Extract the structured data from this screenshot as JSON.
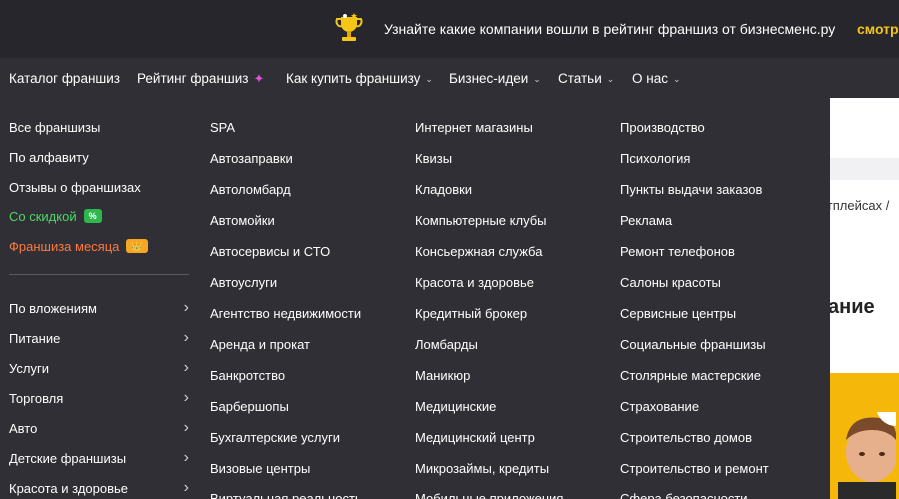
{
  "promo": {
    "text": "Узнайте какие компании вошли в рейтинг франшиз от бизнесменс.ру",
    "link": "смотреть"
  },
  "nav": {
    "catalog": "Каталог франшиз",
    "rating": "Рейтинг франшиз",
    "how_to_buy": "Как купить франшизу",
    "ideas": "Бизнес-идеи",
    "articles": "Статьи",
    "about": "О нас"
  },
  "left_links": {
    "all": "Все франшизы",
    "alphabet": "По алфавиту",
    "reviews": "Отзывы о франшизах",
    "discount": "Со скидкой",
    "discount_badge": "%",
    "month": "Франшиза месяца",
    "month_badge": "👑"
  },
  "categories": [
    "По вложениям",
    "Питание",
    "Услуги",
    "Торговля",
    "Авто",
    "Детские франшизы",
    "Красота и здоровье"
  ],
  "columns": [
    [
      "SPA",
      "Автозаправки",
      "Автоломбард",
      "Автомойки",
      "Автосервисы и СТО",
      "Автоуслуги",
      "Агентство недвижимости",
      "Аренда и прокат",
      "Банкротство",
      "Барбершопы",
      "Бухгалтерские услуги",
      "Визовые центры",
      "Виртуальная реальность"
    ],
    [
      "Интернет магазины",
      "Квизы",
      "Кладовки",
      "Компьютерные клубы",
      "Консьержная служба",
      "Красота и здоровье",
      "Кредитный брокер",
      "Ломбарды",
      "Маникюр",
      "Медицинские",
      "Медицинский центр",
      "Микрозаймы, кредиты",
      "Мобильные приложения"
    ],
    [
      "Производство",
      "Психология",
      "Пункты выдачи заказов",
      "Реклама",
      "Ремонт телефонов",
      "Салоны красоты",
      "Сервисные центры",
      "Социальные франшизы",
      "Столярные мастерские",
      "Страхование",
      "Строительство домов",
      "Строительство и ремонт",
      "Сфера безопасности"
    ]
  ],
  "background": {
    "crumb": "етплейсах /",
    "heading": "ание"
  },
  "colors": {
    "bg": "#2f2f35",
    "promo_bg": "#26262c",
    "accent_yellow": "#f5c518",
    "discount_green": "#4cd964",
    "month_orange": "#ff7a3d",
    "sparkle_pink": "#e34fd8"
  }
}
